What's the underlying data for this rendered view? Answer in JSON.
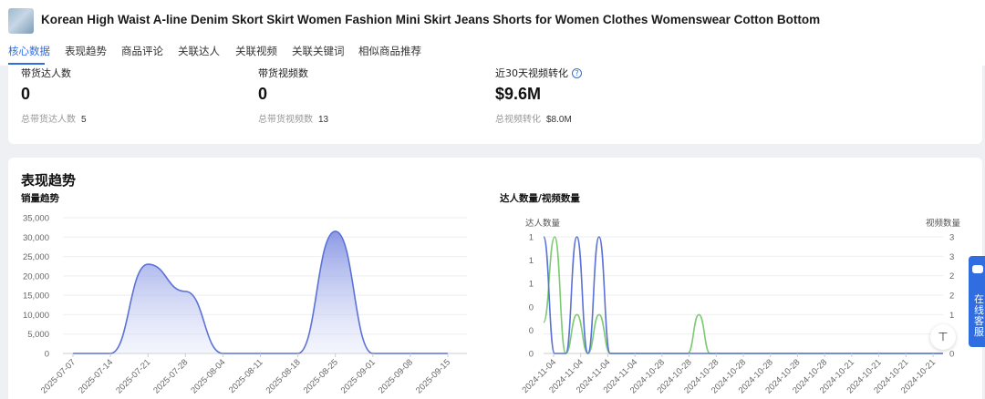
{
  "product": {
    "title": "Korean High Waist A-line Denim Skort Skirt Women Fashion Mini Skirt Jeans Shorts for Women Clothes Womenswear Cotton Bottom"
  },
  "tabs": [
    {
      "label": "核心数据",
      "active": true
    },
    {
      "label": "表现趋势"
    },
    {
      "label": "商品评论"
    },
    {
      "label": "关联达人"
    },
    {
      "label": "关联视频"
    },
    {
      "label": "关联关键词"
    },
    {
      "label": "相似商品推荐"
    }
  ],
  "metrics": [
    {
      "label": "带货达人数",
      "value": "0",
      "sub_label": "总带货达人数",
      "sub_value": "5"
    },
    {
      "label": "带货视频数",
      "value": "0",
      "sub_label": "总带货视频数",
      "sub_value": "13"
    },
    {
      "label": "近30天视频转化",
      "value": "$9.6M",
      "sub_label": "总视频转化",
      "sub_value": "$8.0M",
      "help_icon": "question-circle-icon"
    }
  ],
  "trend": {
    "section_title": "表现趋势",
    "sales_chart_title": "销量趋势",
    "creators_chart_title": "达人数量/视频数量"
  },
  "chart_data": [
    {
      "type": "area",
      "title": "销量趋势",
      "x": [
        "2025-07-07",
        "2025-07-14",
        "2025-07-21",
        "2025-07-28",
        "2025-08-04",
        "2025-08-11",
        "2025-08-18",
        "2025-08-25",
        "2025-09-01",
        "2025-09-08",
        "2025-09-15"
      ],
      "y_ticks": [
        "0",
        "5,000",
        "10,000",
        "15,000",
        "20,000",
        "25,000",
        "30,000",
        "35,000"
      ],
      "ylim": [
        0,
        35000
      ],
      "series": [
        {
          "values": [
            0,
            0,
            23000,
            16000,
            0,
            0,
            0,
            31500,
            0,
            0,
            0
          ],
          "color": "#5b72d6"
        }
      ],
      "grid": true
    },
    {
      "type": "line",
      "title": "达人数量/视频数量",
      "y_left_label": "达人数量",
      "y_right_label": "视频数量",
      "x": [
        "2024-11-04",
        "2024-11-04",
        "2024-11-04",
        "2024-11-04",
        "2024-10-28",
        "2024-10-28",
        "2024-10-28",
        "2024-10-28",
        "2024-10-28",
        "2024-10-28",
        "2024-10-28",
        "2024-10-21",
        "2024-10-21",
        "2024-10-21",
        "2024-10-21"
      ],
      "y_left_ticks": [
        "0",
        "0",
        "0",
        "1",
        "1",
        "1"
      ],
      "y_right_ticks": [
        "0",
        "1",
        "1",
        "2",
        "2",
        "3",
        "3"
      ],
      "ylim_left": [
        0,
        1
      ],
      "ylim_right": [
        0,
        3
      ],
      "series": [
        {
          "values": [
            1,
            0,
            0,
            1,
            0,
            1,
            0,
            0,
            0,
            0,
            0,
            0,
            0,
            0,
            0,
            0,
            0,
            0,
            0,
            0,
            0,
            0,
            0,
            0,
            0,
            0,
            0,
            0,
            0,
            0,
            0,
            0,
            0,
            0,
            0,
            0,
            0
          ],
          "color": "#5b72d6",
          "axis": "left"
        },
        {
          "values": [
            0.8,
            3,
            0,
            1,
            0,
            1,
            0,
            0,
            0,
            0,
            0,
            0,
            0,
            0,
            1,
            0,
            0,
            0,
            0,
            0,
            0,
            0,
            0,
            0,
            0,
            0,
            0,
            0,
            0,
            0,
            0,
            0,
            0,
            0,
            0,
            0,
            0
          ],
          "color": "#7ccb72",
          "axis": "right"
        }
      ]
    }
  ],
  "float": {
    "service_label": "在线客服",
    "chat_icon": "chat-bubble-icon",
    "back_top_icon": "back-to-top-icon",
    "back_top_glyph": "⊤"
  }
}
